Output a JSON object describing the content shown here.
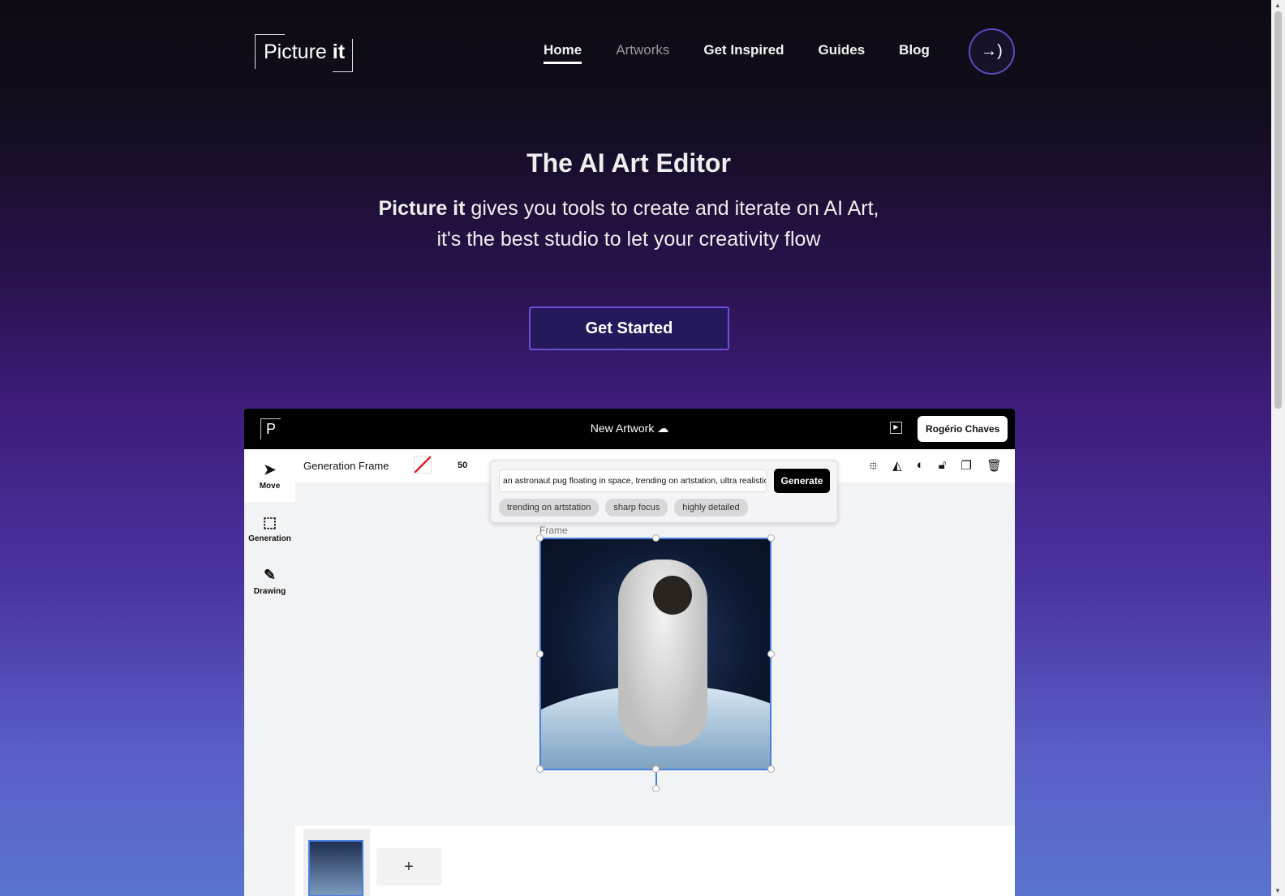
{
  "brand": {
    "name_regular": "Picture",
    "name_bold": "it"
  },
  "nav": {
    "items": [
      {
        "label": "Home"
      },
      {
        "label": "Artworks"
      },
      {
        "label": "Get Inspired"
      },
      {
        "label": "Guides"
      },
      {
        "label": "Blog"
      }
    ],
    "login_icon": "sign-in-arrow-icon"
  },
  "hero": {
    "title": "The AI Art Editor",
    "subtitle_bold": "Picture it",
    "subtitle_rest": " gives you tools to create and iterate on AI Art,",
    "subtitle_line2": "it's the best studio to let your creativity flow",
    "cta": "Get Started"
  },
  "app": {
    "logo": "P",
    "title": "New Artwork",
    "user": "Rogério Chaves",
    "tools": [
      {
        "label": "Move",
        "icon": "pointer-icon"
      },
      {
        "label": "Generation",
        "icon": "frame-icon"
      },
      {
        "label": "Drawing",
        "icon": "brush-icon"
      }
    ],
    "toolbar": {
      "mode": "Generation Frame",
      "size": "50"
    },
    "prompt": {
      "value": "an astronaut pug floating in space, trending on artstation, ultra realistic",
      "generate": "Generate",
      "chips": [
        "trending on artstation",
        "sharp focus",
        "highly detailed"
      ]
    },
    "frame_label": "Frame",
    "add_label": "+"
  }
}
